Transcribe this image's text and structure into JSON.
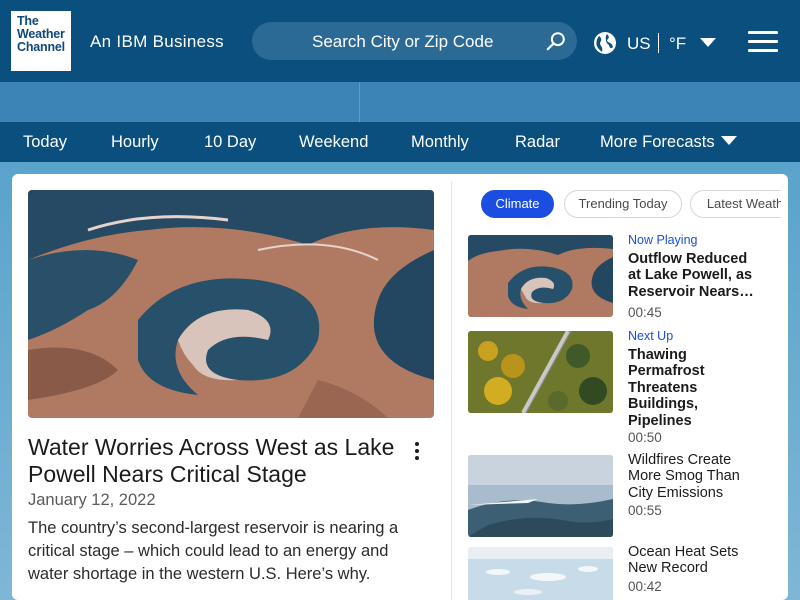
{
  "header": {
    "logo_lines": [
      "The",
      "Weather",
      "Channel"
    ],
    "tagline": "An IBM Business",
    "search_placeholder": "Search City or Zip Code",
    "locale": "US",
    "unit": "°F"
  },
  "nav": {
    "items": [
      "Today",
      "Hourly",
      "10 Day",
      "Weekend",
      "Monthly",
      "Radar",
      "More Forecasts"
    ]
  },
  "article": {
    "title": "Water Worries Across West as Lake Powell Nears Critical Stage",
    "date": "January 12, 2022",
    "description": "The country’s second-largest reservoir is nearing a critical stage – which could lead to an energy and water shortage in the western U.S. Here’s why."
  },
  "playlist": {
    "tabs": [
      "Climate",
      "Trending Today",
      "Latest Weath"
    ],
    "videos": [
      {
        "label": "Now Playing",
        "title": "Outflow Reduced at Lake Powell, as Reservoir Nears…",
        "duration": "00:45"
      },
      {
        "label": "Next Up",
        "title": "Thawing Permafrost Threatens Buildings, Pipelines",
        "duration": "00:50"
      },
      {
        "label": "",
        "title": "Wildfires Create More Smog Than City Emissions",
        "duration": "00:55"
      },
      {
        "label": "",
        "title": "Ocean Heat Sets New Record",
        "duration": "00:42"
      }
    ]
  },
  "colors": {
    "header_bg": "#0a4f7e",
    "ad_strip": "#3b85b6",
    "accent_blue": "#1b4de0"
  }
}
